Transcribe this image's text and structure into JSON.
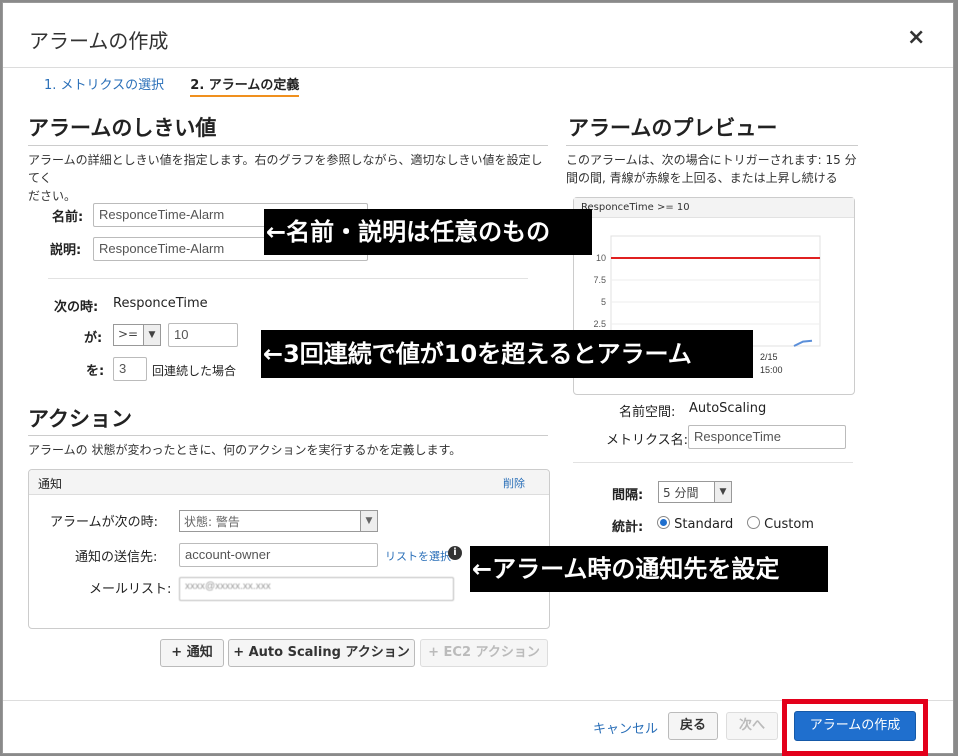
{
  "dialog": {
    "title": "アラームの作成",
    "close": "×"
  },
  "steps": {
    "step1": "1. メトリクスの選択",
    "step2": "2. アラームの定義"
  },
  "threshold": {
    "heading": "アラームのしきい値",
    "desc_line1": "アラームの詳細としきい値を指定します。右のグラフを参照しながら、適切なしきい値を設定してく",
    "desc_line2": "ださい。",
    "name_label": "名前:",
    "name_value": "ResponceTime-Alarm",
    "desc_label": "説明:",
    "desc_value": "ResponceTime-Alarm",
    "when_label": "次の時:",
    "when_metric": "ResponceTime",
    "is_label": "が:",
    "operator": ">=",
    "threshold_value": "10",
    "for_label": "を:",
    "periods": "3",
    "periods_suffix": "回連続した場合"
  },
  "actions": {
    "heading": "アクション",
    "desc": "アラームの 状態が変わったときに、何のアクションを実行するかを定義します。",
    "panel_title": "通知",
    "delete": "削除",
    "state_label": "アラームが次の時:",
    "state_value": "状態: 警告",
    "send_label": "通知の送信先:",
    "send_value": "account-owner",
    "select_list": "リストを選択",
    "email_label": "メールリスト:",
    "email_value": "xxxx@xxxxx.xx.xxx",
    "btn_notify": "+ 通知",
    "btn_autoscaling": "+ Auto Scaling アクション",
    "btn_ec2": "+ EC2 アクション"
  },
  "preview": {
    "heading": "アラームのプレビュー",
    "desc_line1": "このアラームは、次の場合にトリガーされます: 15 分",
    "desc_line2": "間の間, 青線が赤線を上回る、または上昇し続ける",
    "chart_header": "ResponceTime >= 10",
    "ns_label": "名前空間:",
    "ns_value": "AutoScaling",
    "metric_label": "メトリクス名:",
    "metric_value": "ResponceTime",
    "period_label": "間隔:",
    "period_value": "5 分間",
    "stat_label": "統計:",
    "stat_standard": "Standard",
    "stat_custom": "Custom"
  },
  "chart_data": {
    "type": "line",
    "title": "ResponceTime >= 10",
    "y_ticks": [
      "10",
      "7.5",
      "5",
      "2.5"
    ],
    "ylim": [
      0,
      12.5
    ],
    "x_ticks": [
      "2/15",
      "15:00"
    ],
    "threshold": 10,
    "series": [
      {
        "values": [
          0,
          0.5,
          0.6
        ]
      }
    ],
    "colors": {
      "threshold": "#e02020",
      "metric": "#5b8fd9"
    }
  },
  "footer": {
    "cancel": "キャンセル",
    "back": "戻る",
    "next": "次へ",
    "create": "アラームの作成"
  },
  "annotations": {
    "a1": "←名前・説明は任意のもの",
    "a2": "←3回連続で値が10を超えるとアラーム",
    "a3": "←アラーム時の通知先を設定"
  },
  "colors": {
    "highlight": "#e3001b",
    "primary": "#1f6fce",
    "link": "#2a6fb8"
  }
}
